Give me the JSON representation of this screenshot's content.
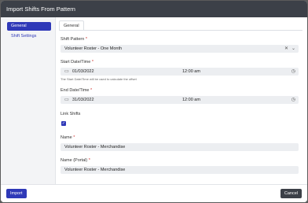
{
  "dialog": {
    "title": "Import Shifts From Pattern",
    "close_glyph": "×"
  },
  "sidebar": {
    "items": [
      {
        "label": "General"
      },
      {
        "label": "Shift Settings"
      }
    ]
  },
  "tabs": [
    {
      "label": "General"
    }
  ],
  "form": {
    "shift_pattern": {
      "label": "Shift Pattern",
      "value": "Volunteer Roster - One Month"
    },
    "start": {
      "label": "Start Date/Time",
      "date": "01/03/2022",
      "time": "12:00 am",
      "hint": "The Start Date/Time will be used to calculate the offset"
    },
    "end": {
      "label": "End Date/Time",
      "date": "31/03/2022",
      "time": "12:00 am"
    },
    "link_shifts": {
      "label": "Link Shifts",
      "checked": true
    },
    "name": {
      "label": "Name",
      "value": "Volunteer Roster - Merchandise"
    },
    "name_portal": {
      "label": "Name (Portal)",
      "value": "Volunteer Roster - Merchandise"
    },
    "required_mark": "*"
  },
  "footer": {
    "import_label": "Import",
    "cancel_label": "Cancel"
  },
  "colors": {
    "accent": "#2f39b8",
    "titlebar": "#3c4048",
    "required": "#d0312d"
  },
  "icons": {
    "clear": "clear-icon",
    "dropdown": "chevron-down-icon",
    "calendar": "calendar-icon",
    "clock": "clock-icon",
    "check": "check-icon"
  }
}
